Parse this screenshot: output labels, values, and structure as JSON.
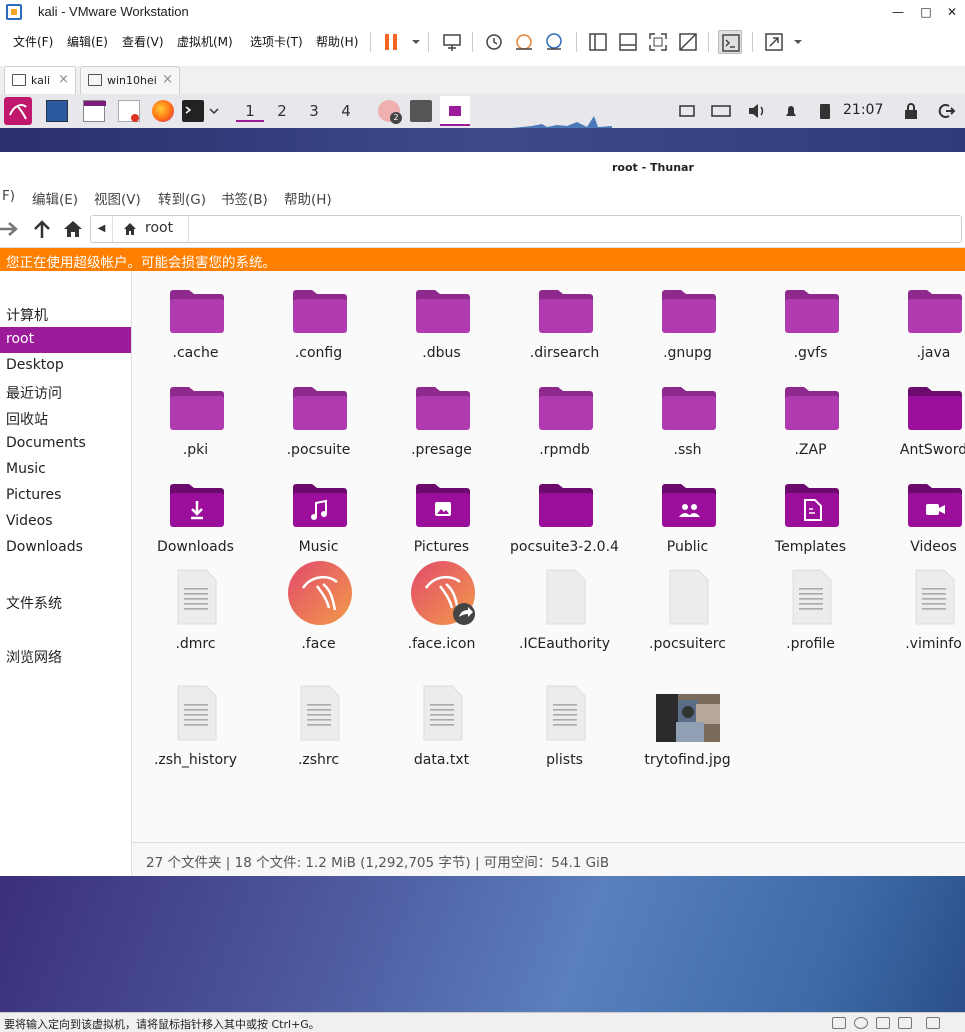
{
  "vmware": {
    "title": "kali - VMware Workstation",
    "menu": [
      "文件(F)",
      "编辑(E)",
      "查看(V)",
      "虚拟机(M)",
      "选项卡(T)",
      "帮助(H)"
    ],
    "tabs": [
      {
        "label": "kali",
        "active": true
      },
      {
        "label": "win10hei",
        "active": false
      }
    ],
    "status_text": "要将输入定向到该虚拟机，请将鼠标指针移入其中或按 Ctrl+G。"
  },
  "kali_panel": {
    "workspaces": [
      "1",
      "2",
      "3",
      "4"
    ],
    "active_workspace": "1",
    "clock": "21:07",
    "badge": "2"
  },
  "thunar": {
    "title": "root - Thunar",
    "menu": [
      "F)",
      "编辑(E)",
      "视图(V)",
      "转到(G)",
      "书签(B)",
      "帮助(H)"
    ],
    "location": "root",
    "warning": "您正在使用超级帐户。可能会损害您的系统。",
    "sidebar": [
      {
        "label": "计算机",
        "active": false
      },
      {
        "label": "root",
        "active": true
      },
      {
        "label": "Desktop",
        "active": false
      },
      {
        "label": "最近访问",
        "active": false
      },
      {
        "label": "回收站",
        "active": false
      },
      {
        "label": "Documents",
        "active": false
      },
      {
        "label": "Music",
        "active": false
      },
      {
        "label": "Pictures",
        "active": false
      },
      {
        "label": "Videos",
        "active": false
      },
      {
        "label": "Downloads",
        "active": false
      },
      {
        "label": "文件系统",
        "active": false
      },
      {
        "label": "浏览网络",
        "active": false
      }
    ],
    "files": [
      {
        "name": ".cache",
        "type": "folder-light"
      },
      {
        "name": ".config",
        "type": "folder-light"
      },
      {
        "name": ".dbus",
        "type": "folder-light"
      },
      {
        "name": ".dirsearch",
        "type": "folder-light"
      },
      {
        "name": ".gnupg",
        "type": "folder-light"
      },
      {
        "name": ".gvfs",
        "type": "folder-light"
      },
      {
        "name": ".java",
        "type": "folder-light"
      },
      {
        "name": ".pki",
        "type": "folder-light"
      },
      {
        "name": ".pocsuite",
        "type": "folder-light"
      },
      {
        "name": ".presage",
        "type": "folder-light"
      },
      {
        "name": ".rpmdb",
        "type": "folder-light"
      },
      {
        "name": ".ssh",
        "type": "folder-light"
      },
      {
        "name": ".ZAP",
        "type": "folder-light"
      },
      {
        "name": "AntSword",
        "type": "folder-dark"
      },
      {
        "name": "Downloads",
        "type": "folder-downloads"
      },
      {
        "name": "Music",
        "type": "folder-music"
      },
      {
        "name": "Pictures",
        "type": "folder-pictures"
      },
      {
        "name": "pocsuite3-2.0.4",
        "type": "folder-dark"
      },
      {
        "name": "Public",
        "type": "folder-public"
      },
      {
        "name": "Templates",
        "type": "folder-templates"
      },
      {
        "name": "Videos",
        "type": "folder-videos"
      },
      {
        "name": ".dmrc",
        "type": "text-file"
      },
      {
        "name": ".face",
        "type": "kali-image"
      },
      {
        "name": ".face.icon",
        "type": "kali-image-link"
      },
      {
        "name": ".ICEauthority",
        "type": "blank-file"
      },
      {
        "name": ".pocsuiterc",
        "type": "blank-file"
      },
      {
        "name": ".profile",
        "type": "text-file"
      },
      {
        "name": ".viminfo",
        "type": "text-file"
      },
      {
        "name": ".zsh_history",
        "type": "text-file"
      },
      {
        "name": ".zshrc",
        "type": "text-file"
      },
      {
        "name": "data.txt",
        "type": "text-file"
      },
      {
        "name": "plists",
        "type": "text-file"
      },
      {
        "name": "trytofind.jpg",
        "type": "photo"
      }
    ],
    "status": "27 个文件夹 | 18 个文件: 1.2 MiB (1,292,705 字节) | 可用空间：54.1 GiB"
  },
  "colors": {
    "accent": "#9b1b9b",
    "folder_light": "#b03ab0",
    "folder_dark": "#9b0e9b",
    "warning": "#ff7f00"
  }
}
